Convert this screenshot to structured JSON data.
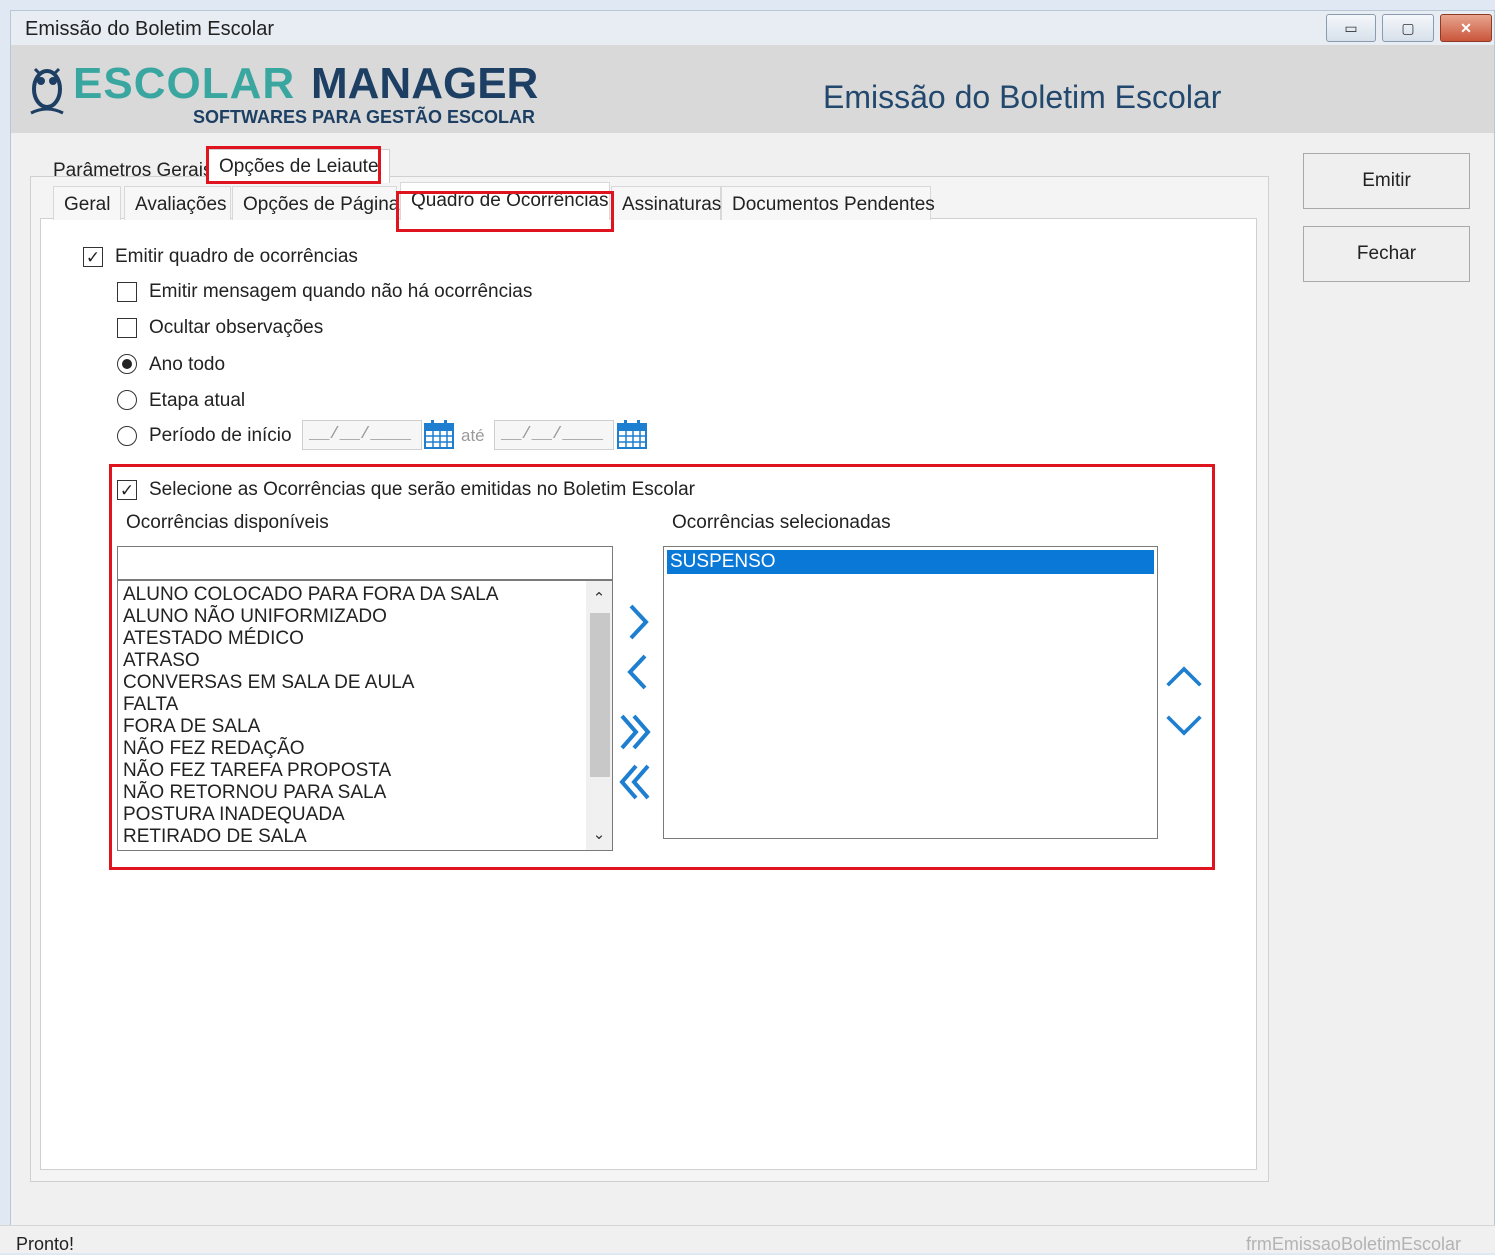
{
  "window": {
    "title": "Emissão do Boletim Escolar",
    "controls": {
      "minimize": "▭",
      "maximize": "▢",
      "close": "✕"
    }
  },
  "header": {
    "logo_escolar": "ESCOLAR",
    "logo_manager": "MANAGER",
    "logo_subtitle": "SOFTWARES PARA GESTÃO ESCOLAR",
    "title": "Emissão do Boletim Escolar"
  },
  "outer_tabs": [
    {
      "label": "Parâmetros Gerais",
      "active": false
    },
    {
      "label": "Opções de Leiaute",
      "active": true
    }
  ],
  "inner_tabs": [
    {
      "label": "Geral",
      "active": false
    },
    {
      "label": "Avaliações",
      "active": false
    },
    {
      "label": "Opções de Página",
      "active": false
    },
    {
      "label": "Quadro de Ocorrências",
      "active": true
    },
    {
      "label": "Assinaturas",
      "active": false
    },
    {
      "label": "Documentos Pendentes",
      "active": false
    }
  ],
  "options": {
    "emitir_quadro": {
      "label": "Emitir quadro de ocorrências",
      "checked": true
    },
    "emitir_mensagem": {
      "label": "Emitir mensagem quando não há ocorrências",
      "checked": false
    },
    "ocultar_observacoes": {
      "label": "Ocultar observações",
      "checked": false
    },
    "ano_todo": {
      "label": "Ano todo",
      "selected": true
    },
    "etapa_atual": {
      "label": "Etapa atual",
      "selected": false
    },
    "periodo_inicio": {
      "label": "Período de início",
      "selected": false
    },
    "date_start_value": "__/__/____",
    "date_end_value": "__/__/____",
    "ate_label": "até"
  },
  "selection": {
    "checkbox_label": "Selecione as Ocorrências que serão emitidas no Boletim Escolar",
    "checkbox_checked": true,
    "available_label": "Ocorrências disponíveis",
    "selected_label": "Ocorrências selecionadas",
    "filter_value": "",
    "available_items": [
      "ALUNO COLOCADO PARA FORA DA SALA",
      "ALUNO NÃO UNIFORMIZADO",
      "ATESTADO MÉDICO",
      "ATRASO",
      "CONVERSAS EM SALA DE AULA",
      "FALTA",
      "FORA DE SALA",
      "NÃO FEZ REDAÇÃO",
      "NÃO FEZ TAREFA PROPOSTA",
      "NÃO RETORNOU PARA SALA",
      "POSTURA INADEQUADA",
      "RETIRADO DE SALA"
    ],
    "selected_items": [
      "SUSPENSO"
    ]
  },
  "buttons": {
    "emitir": "Emitir",
    "fechar": "Fechar"
  },
  "status": {
    "left": "Pronto!",
    "right": "frmEmissaoBoletimEscolar"
  },
  "colors": {
    "accent_blue": "#0a78d7",
    "highlight_red": "#e0141e",
    "arrow_blue": "#1e7fd0"
  }
}
